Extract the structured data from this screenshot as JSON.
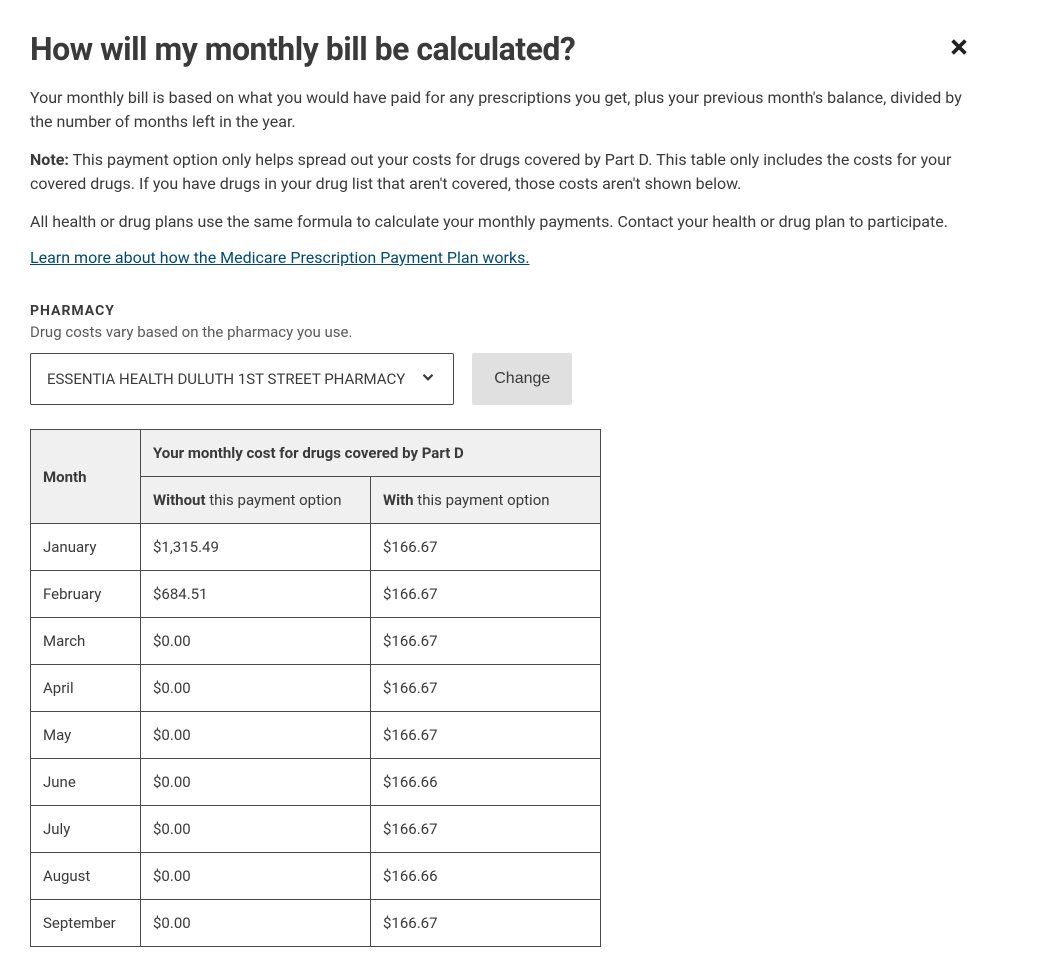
{
  "title": "How will my monthly bill be calculated?",
  "para1": "Your monthly bill is based on what you would have paid for any prescriptions you get, plus your previous month's balance, divided by the number of months left in the year.",
  "note_label": "Note:",
  "note_text": " This payment option only helps spread out your costs for drugs covered by Part D. This table only includes the costs for your covered drugs. If you have drugs in your drug list that aren't covered, those costs aren't shown below.",
  "para3": "All health or drug plans use the same formula to calculate your monthly payments. Contact your health or drug plan to participate.",
  "learn_link": "Learn more about how the Medicare Prescription Payment Plan works.",
  "pharmacy": {
    "label": "PHARMACY",
    "sub": "Drug costs vary based on the pharmacy you use.",
    "selected": "ESSENTIA HEALTH DULUTH 1ST STREET PHARMACY",
    "change_label": "Change"
  },
  "table": {
    "month_header": "Month",
    "group_header": "Your monthly cost for drugs covered by Part D",
    "without_bold": "Without",
    "without_rest": " this payment option",
    "with_bold": "With",
    "with_rest": " this payment option",
    "rows": [
      {
        "month": "January",
        "without": "$1,315.49",
        "with": "$166.67"
      },
      {
        "month": "February",
        "without": "$684.51",
        "with": "$166.67"
      },
      {
        "month": "March",
        "without": "$0.00",
        "with": "$166.67"
      },
      {
        "month": "April",
        "without": "$0.00",
        "with": "$166.67"
      },
      {
        "month": "May",
        "without": "$0.00",
        "with": "$166.67"
      },
      {
        "month": "June",
        "without": "$0.00",
        "with": "$166.66"
      },
      {
        "month": "July",
        "without": "$0.00",
        "with": "$166.67"
      },
      {
        "month": "August",
        "without": "$0.00",
        "with": "$166.66"
      },
      {
        "month": "September",
        "without": "$0.00",
        "with": "$166.67"
      }
    ]
  }
}
